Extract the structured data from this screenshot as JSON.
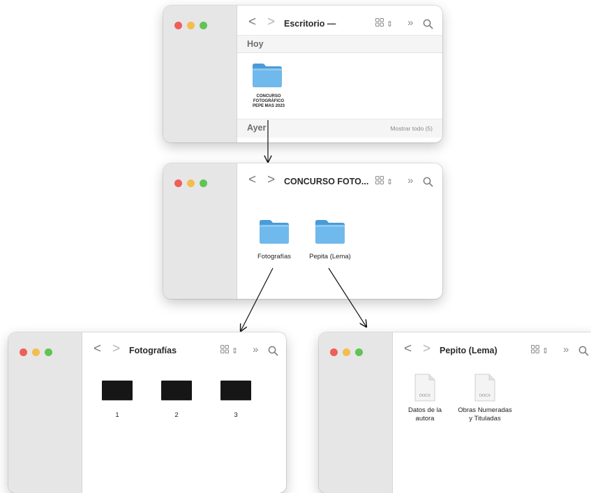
{
  "windows": [
    {
      "id": "escritorio",
      "title": "Escritorio —",
      "sections": [
        {
          "label": "Hoy"
        },
        {
          "label": "Ayer",
          "link": "Mostrar todo (5)"
        }
      ],
      "items": [
        {
          "type": "folder",
          "label_lines": [
            "CONCURSO",
            "FOTOGRÁFICO",
            "PEPE MAS 2023"
          ]
        }
      ]
    },
    {
      "id": "concurso",
      "title": "CONCURSO FOTO...",
      "items": [
        {
          "type": "folder",
          "label": "Fotografías"
        },
        {
          "type": "folder",
          "label": "Pepita (Lema)"
        }
      ]
    },
    {
      "id": "fotografias",
      "title": "Fotografías",
      "items": [
        {
          "type": "image",
          "label": "1"
        },
        {
          "type": "image",
          "label": "2"
        },
        {
          "type": "image",
          "label": "3"
        }
      ]
    },
    {
      "id": "pepito",
      "title": "Pepito (Lema)",
      "items": [
        {
          "type": "document",
          "ext": "DOCX",
          "label_lines": [
            "Datos de la",
            "autora"
          ]
        },
        {
          "type": "document",
          "ext": "DOCX",
          "label_lines": [
            "Obras Numeradas",
            "y Tituladas"
          ]
        }
      ]
    }
  ],
  "toolbar": {
    "back_icon": "chevron-left-icon",
    "forward_icon": "chevron-right-icon",
    "view_icon": "grid-view-icon",
    "more_icon": "double-chevron-icon",
    "search_icon": "search-icon"
  },
  "colors": {
    "folder": "#6fb8ec",
    "folder_tab": "#4a9bd8",
    "traffic_red": "#ee5f57",
    "traffic_yellow": "#f4bd4f",
    "traffic_green": "#5fc453"
  }
}
